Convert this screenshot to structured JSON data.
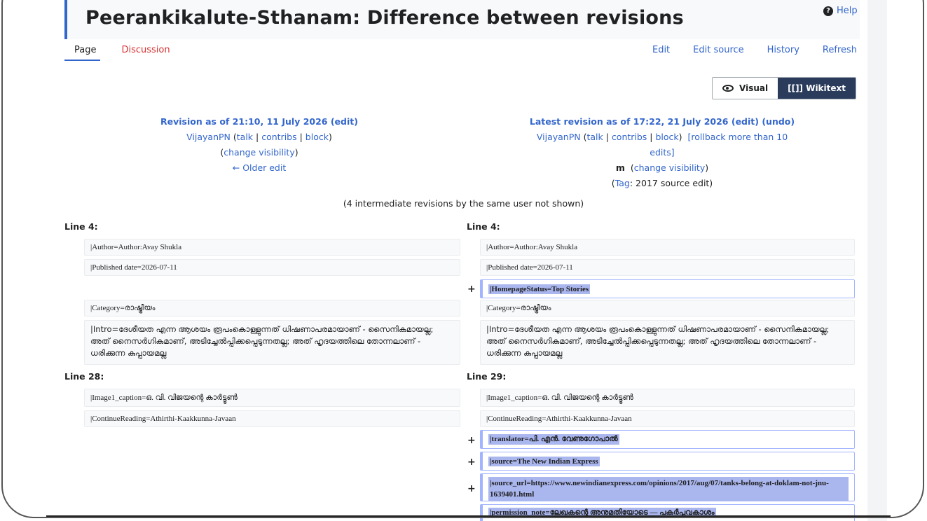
{
  "page": {
    "title": "Peerankikalute-Sthanam: Difference between revisions",
    "help": "Help"
  },
  "tabs_left": [
    "Page",
    "Discussion"
  ],
  "tabs_right": [
    "Edit",
    "Edit source",
    "History",
    "Refresh"
  ],
  "switch": {
    "visual": "Visual",
    "wikitext": "[[]] Wikitext"
  },
  "left_rev": {
    "heading": "Revision as of 21:10, 11 July 2026",
    "edit": "(edit)",
    "user": "VijayanPN",
    "talk": "talk",
    "contribs": "contribs",
    "block": "block",
    "visibility": "change visibility",
    "older": "← Older edit"
  },
  "right_rev": {
    "heading": "Latest revision as of 17:22, 21 July 2026",
    "edit": "(edit)",
    "undo": "(undo)",
    "user": "VijayanPN",
    "talk": "talk",
    "contribs": "contribs",
    "block": "block",
    "rollback": "[rollback more than 10 edits]",
    "minor": "m",
    "visibility": "change visibility",
    "tag_label": "Tag",
    "tag_value": ": 2017 source edit)"
  },
  "intermediate": "(4 intermediate revisions by the same user not shown)",
  "diff": {
    "left_line_a": "Line 4:",
    "right_line_a": "Line 4:",
    "left_line_b": "Line 28:",
    "right_line_b": "Line 29:",
    "author": "|Author=Author:Avay Shukla",
    "published": "|Published date=2026-07-11",
    "homepage": "|HomepageStatus=Top Stories",
    "category": "|Category=രാഷ്ട്രീയം",
    "intro": "|Intro=ദേശീയത എന്ന ആശയം രൂപംകൊള്ളുന്നത് ധിഷണാപരമായാണ് - സൈനികമായല്ല; അത് നൈസർഗികമാണ്, അടിച്ചേൽപ്പിക്കപ്പെടുന്നതല്ല; അത് ഹൃദയത്തിലെ തോന്നലാണ് - ധരിക്കുന്ന കുപ്പായമല്ല",
    "caption": "|Image1_caption=ഒ. വി. വിജയന്റെ കാർട്ടൂൺ",
    "continue": "|ContinueReading=Athirthi-Kaakkunna-Javaan",
    "translator": "|translator=പി. എൻ. വേണുഗോപാൽ",
    "source": "|source=The New Indian Express",
    "source_url": "|source_url=https://www.newindianexpress.com/opinions/2017/aug/07/tanks-belong-at-doklam-not-jnu-1639401.html",
    "permission": "|permission_note=ലേഖകന്റെ അനുമതിയോടെ — പകർപ്പവകാശം",
    "plus": "+"
  }
}
